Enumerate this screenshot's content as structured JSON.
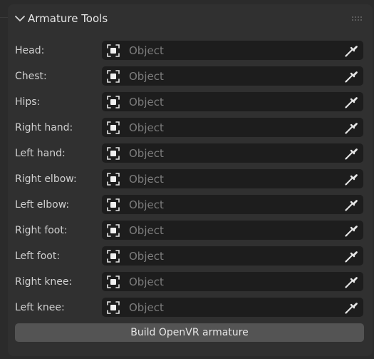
{
  "panel": {
    "title": "Armature Tools",
    "fields": [
      {
        "label": "Head:",
        "placeholder": "Object"
      },
      {
        "label": "Chest:",
        "placeholder": "Object"
      },
      {
        "label": "Hips:",
        "placeholder": "Object"
      },
      {
        "label": "Right hand:",
        "placeholder": "Object"
      },
      {
        "label": "Left hand:",
        "placeholder": "Object"
      },
      {
        "label": "Right elbow:",
        "placeholder": "Object"
      },
      {
        "label": "Left elbow:",
        "placeholder": "Object"
      },
      {
        "label": "Right foot:",
        "placeholder": "Object"
      },
      {
        "label": "Left foot:",
        "placeholder": "Object"
      },
      {
        "label": "Right knee:",
        "placeholder": "Object"
      },
      {
        "label": "Left knee:",
        "placeholder": "Object"
      }
    ],
    "button_label": "Build OpenVR armature"
  },
  "icons": {
    "collapse": "chevron-down-icon",
    "grip": "drag-grip-icon",
    "object": "object-icon",
    "eyedropper": "eyedropper-icon"
  },
  "colors": {
    "panel_bg": "#303030",
    "field_bg": "#1d1d1d",
    "button_bg": "#545454",
    "text": "#d0d0d0",
    "placeholder": "#7c7c7c"
  }
}
